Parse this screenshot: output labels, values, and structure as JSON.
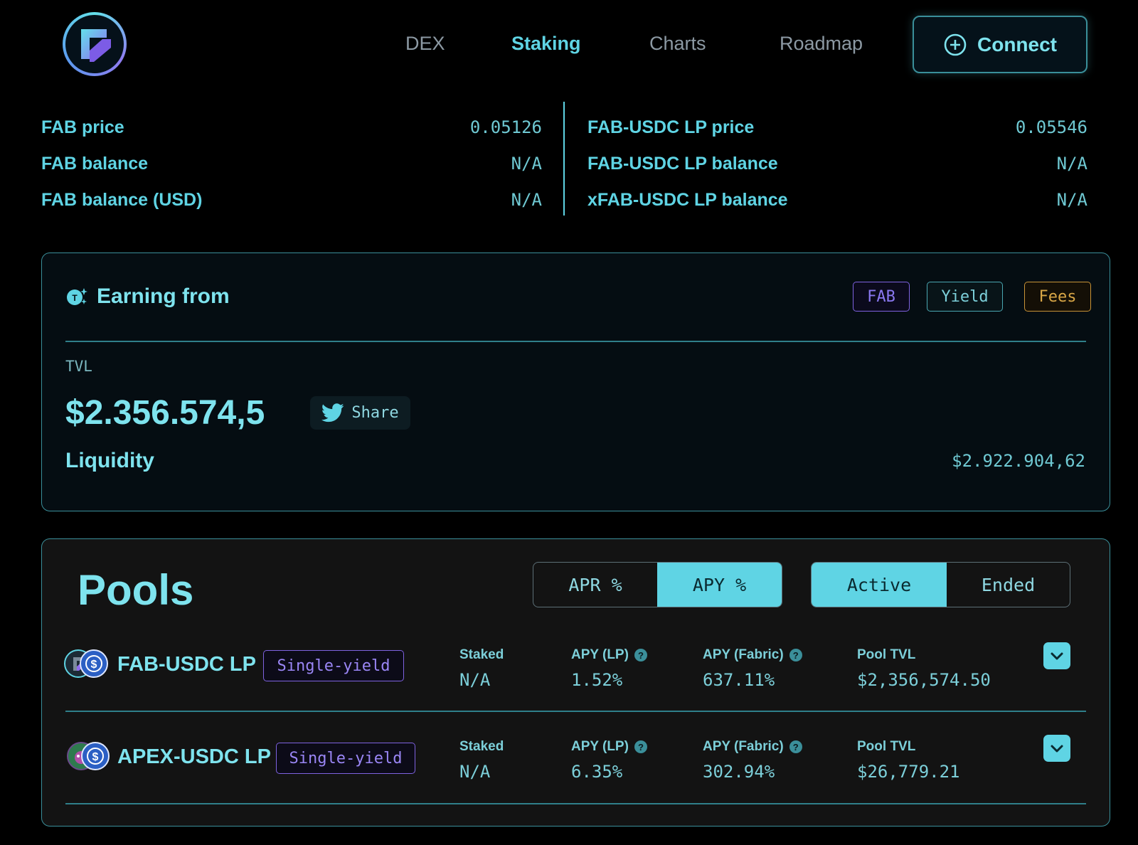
{
  "nav": {
    "items": [
      "DEX",
      "Staking",
      "Charts",
      "Roadmap"
    ],
    "active": "Staking",
    "connect_label": "Connect"
  },
  "stats": {
    "left": [
      {
        "label": "FAB price",
        "value": "0.05126"
      },
      {
        "label": "FAB balance",
        "value": "N/A"
      },
      {
        "label": "FAB balance (USD)",
        "value": "N/A"
      }
    ],
    "right": [
      {
        "label": "FAB-USDC LP price",
        "value": "0.05546"
      },
      {
        "label": "FAB-USDC LP balance",
        "value": "N/A"
      },
      {
        "label": "xFAB-USDC LP balance",
        "value": "N/A"
      }
    ]
  },
  "earning": {
    "title": "Earning from",
    "tags": [
      "FAB",
      "Yield",
      "Fees"
    ],
    "tvl_label": "TVL",
    "tvl_value": "$2.356.574,5",
    "share_label": "Share",
    "liquidity_label": "Liquidity",
    "liquidity_value": "$2.922.904,62"
  },
  "pools": {
    "title": "Pools",
    "rate_toggle": {
      "options": [
        "APR %",
        "APY %"
      ],
      "selected": "APY %"
    },
    "status_toggle": {
      "options": [
        "Active",
        "Ended"
      ],
      "selected": "Active"
    },
    "columns": [
      "Staked",
      "APY (LP)",
      "APY (Fabric)",
      "Pool TVL"
    ],
    "rows": [
      {
        "name": "FAB-USDC LP",
        "badge": "Single-yield",
        "staked": "N/A",
        "apy_lp": "1.52%",
        "apy_fabric": "637.11%",
        "pool_tvl": "$2,356,574.50"
      },
      {
        "name": "APEX-USDC LP",
        "badge": "Single-yield",
        "staked": "N/A",
        "apy_lp": "6.35%",
        "apy_fabric": "302.94%",
        "pool_tvl": "$26,779.21"
      }
    ]
  },
  "colors": {
    "accent": "#5fd4e4",
    "purple": "#7e62e0",
    "gold": "#c99337",
    "background": "#000000"
  },
  "icons": [
    "logo",
    "plus-circle-icon",
    "coins-icon",
    "twitter-icon",
    "question-icon",
    "chevron-down-icon",
    "usdc-icon"
  ]
}
